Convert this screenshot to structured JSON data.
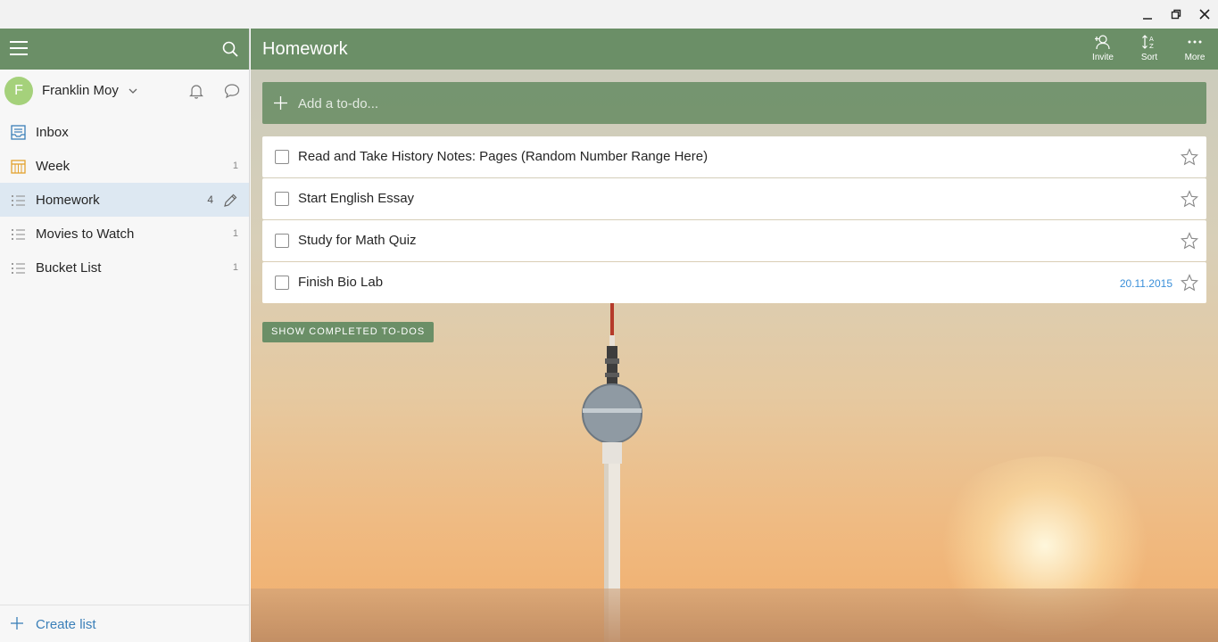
{
  "window": {
    "minimize_icon": "minimize-icon",
    "restore_icon": "restore-icon",
    "close_icon": "close-icon"
  },
  "sidebar": {
    "user": {
      "initial": "F",
      "name": "Franklin Moy"
    },
    "lists": [
      {
        "label": "Inbox",
        "count": "",
        "icon": "inbox-icon"
      },
      {
        "label": "Week",
        "count": "1",
        "icon": "calendar-icon"
      },
      {
        "label": "Homework",
        "count": "4",
        "icon": "list-icon",
        "active": true
      },
      {
        "label": "Movies to Watch",
        "count": "1",
        "icon": "list-icon"
      },
      {
        "label": "Bucket List",
        "count": "1",
        "icon": "list-icon"
      }
    ],
    "create_list": "Create list"
  },
  "main": {
    "title": "Homework",
    "actions": {
      "invite": "Invite",
      "sort": "Sort",
      "more": "More"
    },
    "add_placeholder": "Add a to-do...",
    "tasks": [
      {
        "title": "Read and Take History Notes: Pages (Random Number Range Here)",
        "due": ""
      },
      {
        "title": "Start English Essay",
        "due": ""
      },
      {
        "title": "Study for Math Quiz",
        "due": ""
      },
      {
        "title": "Finish Bio Lab",
        "due": "20.11.2015"
      }
    ],
    "show_completed": "SHOW COMPLETED TO-DOS"
  },
  "colors": {
    "header_green": "#6b8f67",
    "active_row": "#dde8f2",
    "link_blue": "#3a7fb8",
    "due_date_blue": "#3a8fd9",
    "avatar_green": "#a5d17b"
  }
}
